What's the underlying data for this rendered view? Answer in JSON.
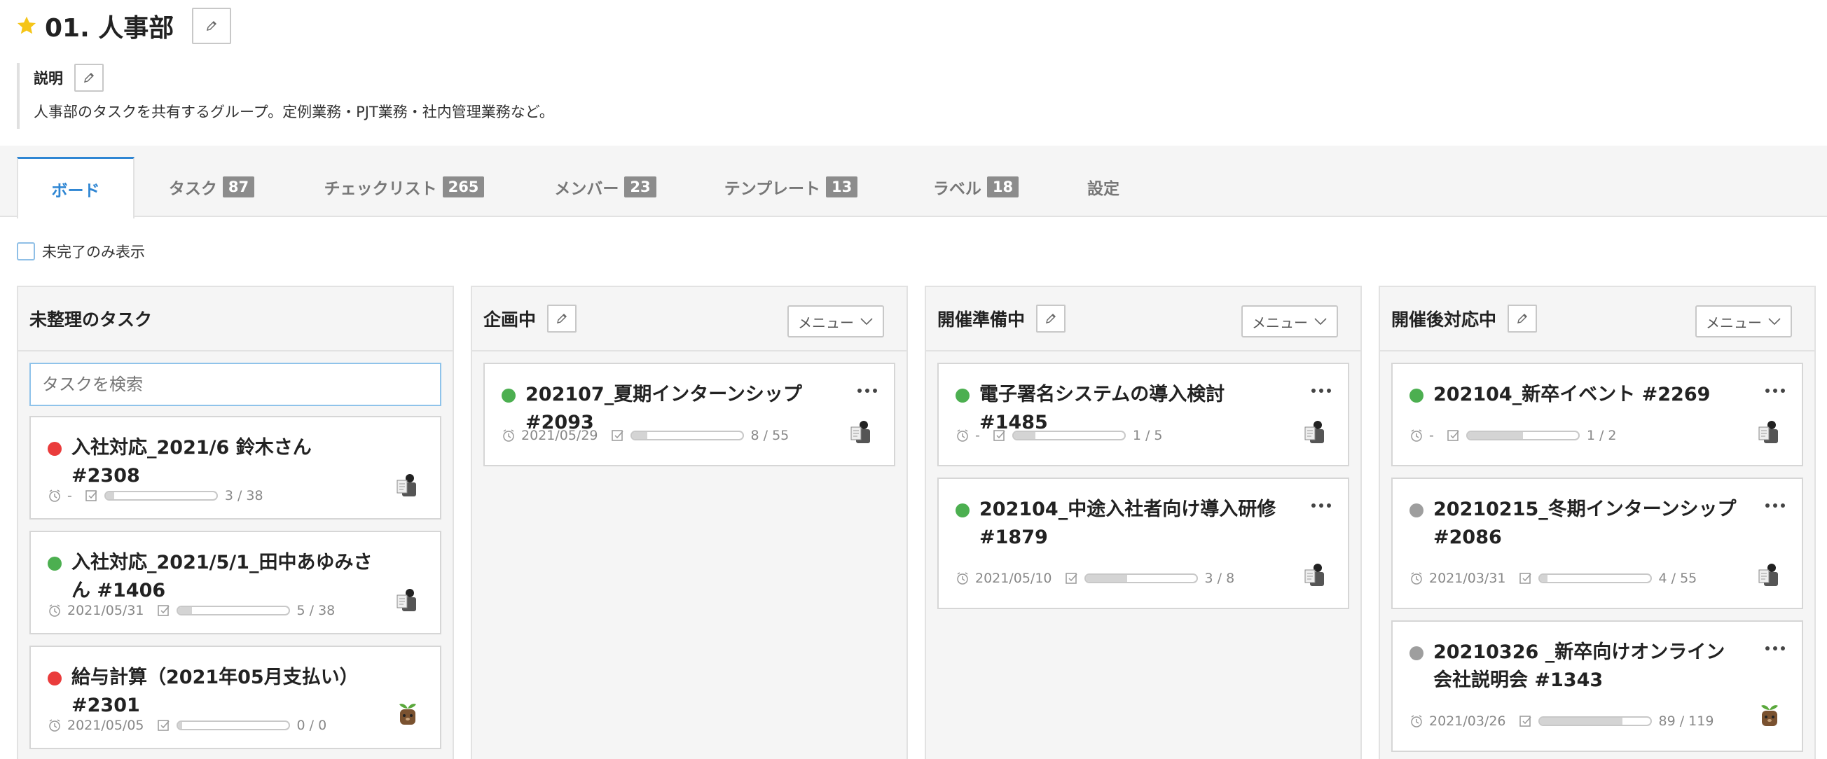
{
  "header": {
    "title": "01. 人事部"
  },
  "description": {
    "label": "説明",
    "text": "人事部のタスクを共有するグループ。定例業務・PJT業務・社内管理業務など。"
  },
  "tabs": [
    {
      "label": "ボード",
      "count": null
    },
    {
      "label": "タスク",
      "count": "87"
    },
    {
      "label": "チェックリスト",
      "count": "265"
    },
    {
      "label": "メンバー",
      "count": "23"
    },
    {
      "label": "テンプレート",
      "count": "13"
    },
    {
      "label": "ラベル",
      "count": "18"
    },
    {
      "label": "設定",
      "count": null
    }
  ],
  "filter": {
    "label": "未完了のみ表示",
    "checked": false
  },
  "menu_label": "メニュー",
  "columns": [
    {
      "title": "未整理のタスク",
      "search_placeholder": "タスクを検索",
      "cards": [
        {
          "title": "入社対応_2021/6 鈴木さん #2308",
          "status": "red",
          "date": "-",
          "done": 3,
          "total": 38,
          "progress_label": "3 / 38",
          "avatar": "person-avatar"
        },
        {
          "title": "入社対応_2021/5/1_田中あゆみさん #1406",
          "status": "green",
          "date": "2021/05/31",
          "done": 5,
          "total": 38,
          "progress_label": "5 / 38",
          "avatar": "person-avatar"
        },
        {
          "title": "給与計算（2021年05月支払い） #2301",
          "status": "red",
          "date": "2021/05/05",
          "done": 0,
          "total": 0,
          "progress_label": "0 / 0",
          "avatar": "sprout-avatar"
        }
      ]
    },
    {
      "title": "企画中",
      "cards": [
        {
          "title": "202107_夏期インターンシップ #2093",
          "status": "green",
          "date": "2021/05/29",
          "done": 8,
          "total": 55,
          "progress_label": "8 / 55",
          "avatar": "person-avatar"
        }
      ]
    },
    {
      "title": "開催準備中",
      "cards": [
        {
          "title": "電子署名システムの導入検討 #1485",
          "status": "green",
          "date": "-",
          "done": 1,
          "total": 5,
          "progress_label": "1 / 5",
          "avatar": "person-avatar"
        },
        {
          "title": "202104_中途入社者向け導入研修 #1879",
          "status": "green",
          "date": "2021/05/10",
          "done": 3,
          "total": 8,
          "progress_label": "3 / 8",
          "avatar": "person-avatar"
        }
      ]
    },
    {
      "title": "開催後対応中",
      "cards": [
        {
          "title": "202104_新卒イベント #2269",
          "status": "green",
          "date": "-",
          "done": 1,
          "total": 2,
          "progress_label": "1 / 2",
          "avatar": "person-avatar"
        },
        {
          "title": "20210215_冬期インターンシップ #2086",
          "status": "gray",
          "date": "2021/03/31",
          "done": 4,
          "total": 55,
          "progress_label": "4 / 55",
          "avatar": "person-avatar"
        },
        {
          "title": "20210326 _新卒向けオンライン会社説明会 #1343",
          "status": "gray",
          "date": "2021/03/26",
          "done": 89,
          "total": 119,
          "progress_label": "89 / 119",
          "avatar": "sprout-avatar"
        }
      ]
    }
  ],
  "colors": {
    "accent": "#2f86d3",
    "badge": "#8c8c8c",
    "star": "#f5c518",
    "red": "#ea3c3c",
    "green": "#4caf50",
    "gray": "#9e9e9e"
  }
}
